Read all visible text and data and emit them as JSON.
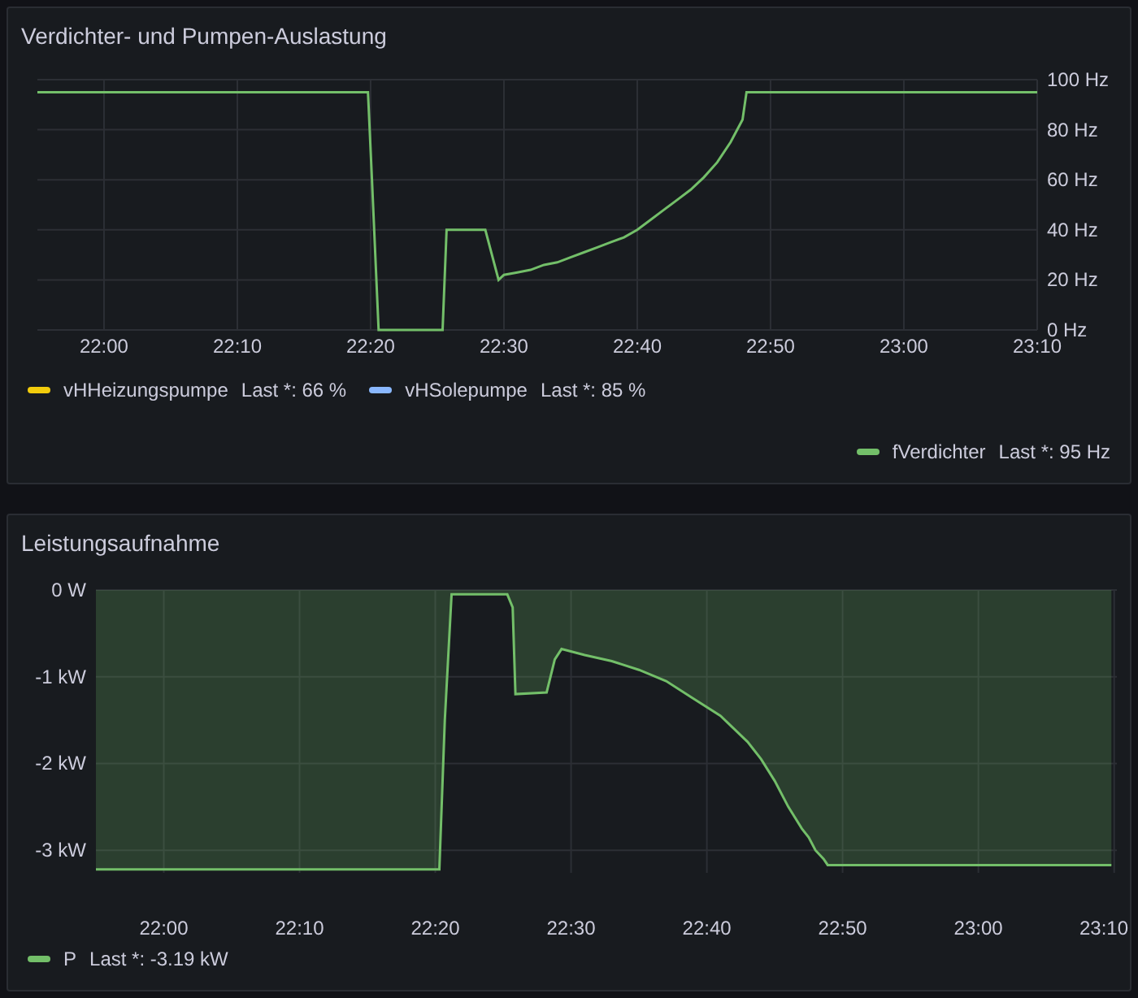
{
  "panels": [
    {
      "title": "Verdichter- und Pumpen-Auslastung",
      "chart_data": {
        "type": "line",
        "grid": true,
        "xlim": [
          21.9167,
          23.1667
        ],
        "ylim": [
          0,
          100
        ],
        "xticks": [
          {
            "value": 22,
            "label": "22:00"
          },
          {
            "value": 22.1667,
            "label": "22:10"
          },
          {
            "value": 22.3333,
            "label": "22:20"
          },
          {
            "value": 22.5,
            "label": "22:30"
          },
          {
            "value": 22.6667,
            "label": "22:40"
          },
          {
            "value": 22.8333,
            "label": "22:50"
          },
          {
            "value": 23,
            "label": "23:00"
          },
          {
            "value": 23.1667,
            "label": "23:10"
          }
        ],
        "yticks": [
          {
            "value": 0,
            "label": "0 Hz"
          },
          {
            "value": 20,
            "label": "20 Hz"
          },
          {
            "value": 40,
            "label": "40 Hz"
          },
          {
            "value": 60,
            "label": "60 Hz"
          },
          {
            "value": 80,
            "label": "80 Hz"
          },
          {
            "value": 100,
            "label": "100 Hz"
          }
        ],
        "x": [
          21.9167,
          22.33,
          22.335,
          22.3433,
          22.4233,
          22.4283,
          22.4417,
          22.4583,
          22.4767,
          22.4933,
          22.5,
          22.5167,
          22.5333,
          22.55,
          22.5667,
          22.5833,
          22.6,
          22.6167,
          22.6333,
          22.65,
          22.6667,
          22.6833,
          22.7,
          22.7167,
          22.7333,
          22.75,
          22.7667,
          22.7833,
          22.7983,
          22.8033,
          23.1667
        ],
        "series": [
          {
            "name": "fVerdichter",
            "color": "#73bf69",
            "values": [
              95,
              95,
              60,
              0,
              0,
              40,
              40,
              40,
              40,
              20,
              22,
              23,
              24,
              26,
              27,
              29,
              31,
              33,
              35,
              37,
              40,
              44,
              48,
              52,
              56,
              61,
              67,
              75,
              84,
              95,
              95
            ]
          }
        ]
      },
      "legend_rows": [
        [
          {
            "name": "vHHeizungspumpe",
            "color": "#f2cc0c",
            "reading": "Last *: 66 %"
          },
          {
            "name": "vHSolepumpe",
            "color": "#8ab8ff",
            "reading": "Last *: 85 %"
          }
        ],
        [
          {
            "kind": "series",
            "reading": "Last *: 95 Hz"
          }
        ]
      ]
    },
    {
      "title": "Leistungsaufnahme",
      "chart_data": {
        "type": "area",
        "grid": true,
        "xlim": [
          21.9167,
          23.17
        ],
        "ylim": [
          -3.26,
          0
        ],
        "xticks": [
          {
            "value": 22,
            "label": "22:00"
          },
          {
            "value": 22.1667,
            "label": "22:10"
          },
          {
            "value": 22.3333,
            "label": "22:20"
          },
          {
            "value": 22.5,
            "label": "22:30"
          },
          {
            "value": 22.6667,
            "label": "22:40"
          },
          {
            "value": 22.8333,
            "label": "22:50"
          },
          {
            "value": 23,
            "label": "23:00"
          },
          {
            "value": 23.1667,
            "label": "23:10"
          }
        ],
        "yticks": [
          {
            "value": 0,
            "label": "0 W"
          },
          {
            "value": -1,
            "label": "-1 kW"
          },
          {
            "value": -2,
            "label": "-2 kW"
          },
          {
            "value": -3,
            "label": "-3 kW"
          }
        ],
        "x": [
          21.9167,
          22.3383,
          22.345,
          22.3533,
          22.4217,
          22.4283,
          22.4317,
          22.47,
          22.48,
          22.4883,
          22.5167,
          22.55,
          22.5833,
          22.6167,
          22.65,
          22.6833,
          22.7167,
          22.7333,
          22.75,
          22.7667,
          22.7833,
          22.7917,
          22.8,
          22.81,
          22.815,
          23.1633
        ],
        "series": [
          {
            "name": "P",
            "color": "#73bf69",
            "values": [
              -3.22,
              -3.22,
              -1.5,
              -0.05,
              -0.05,
              -0.2,
              -1.2,
              -1.18,
              -0.8,
              -0.68,
              -0.75,
              -0.82,
              -0.92,
              -1.05,
              -1.25,
              -1.45,
              -1.75,
              -1.95,
              -2.2,
              -2.5,
              -2.75,
              -2.85,
              -3.0,
              -3.1,
              -3.17,
              -3.17
            ]
          }
        ]
      },
      "legend_rows": [
        [
          {
            "kind": "series",
            "reading": "Last *: -3.19 kW"
          }
        ]
      ]
    }
  ]
}
